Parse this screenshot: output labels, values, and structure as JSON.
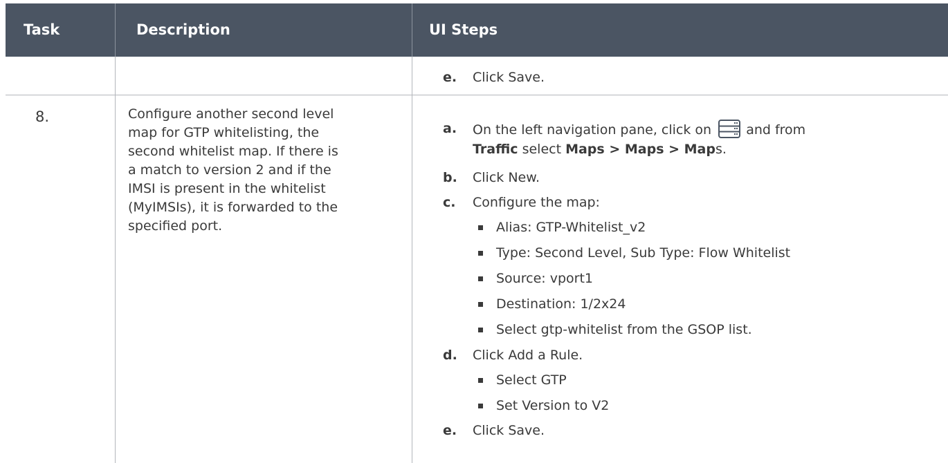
{
  "headers": {
    "task": "Task",
    "description": "Description",
    "ui_steps": "UI Steps"
  },
  "row_prev": {
    "step_e": {
      "letter": "e.",
      "text": "Click Save."
    }
  },
  "row8": {
    "task": "8.",
    "description_lines": [
      "Configure another second level",
      "map for GTP whitelisting, the",
      "second whitelist map. If there is",
      "a match to version 2 and if the",
      "IMSI is present in the whitelist",
      "(MyIMSIs), it is forwarded to the",
      "specified port."
    ],
    "steps": {
      "a": {
        "letter": "a.",
        "line1": "On the left navigation pane, click on",
        "line1_after": "and from",
        "line2_bold1": "Traffic",
        "line2_mid": " select ",
        "line2_bold2": "Maps > Maps > Map",
        "line2_end": "s."
      },
      "b": {
        "letter": "b.",
        "text": "Click New."
      },
      "c": {
        "letter": "c.",
        "text": "Configure the map:",
        "bullets": [
          "Alias: GTP-Whitelist_v2",
          "Type: Second Level, Sub Type: Flow Whitelist",
          "Source: vport1",
          "Destination: 1/2x24",
          "Select gtp-whitelist from the GSOP list."
        ]
      },
      "d": {
        "letter": "d.",
        "text": "Click Add a Rule.",
        "bullets": [
          "Select GTP",
          "Set Version to V2"
        ]
      },
      "e": {
        "letter": "e.",
        "text": "Click Save."
      }
    },
    "icons": {
      "nav": "navigation-menu-icon"
    }
  },
  "colors": {
    "header_bg": "#4b5563",
    "header_text": "#ffffff",
    "grid": "#b3b6bb",
    "body_text": "#3a3a3a"
  }
}
